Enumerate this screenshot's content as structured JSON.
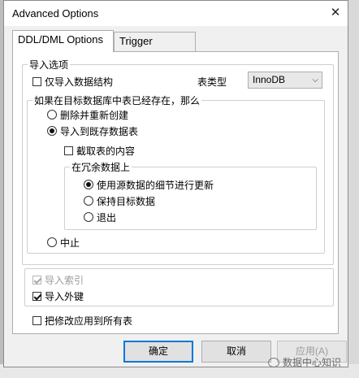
{
  "window": {
    "title": "Advanced Options",
    "close_glyph": "✕"
  },
  "tabs": [
    {
      "label": "DDL/DML Options",
      "active": true
    },
    {
      "label": "Trigger Options",
      "active": false
    }
  ],
  "import_group": {
    "legend": "导入选项",
    "only_structure": {
      "label": "仅导入数据结构",
      "checked": false
    },
    "table_type_label": "表类型",
    "table_type_value": "InnoDB",
    "exists_group": {
      "legend": "如果在目标数据库中表已经存在，那么",
      "delete_recreate": {
        "label": "删除并重新创建",
        "checked": false
      },
      "import_existing": {
        "label": "导入到既存数据表",
        "checked": true
      },
      "truncate": {
        "label": "截取表的内容",
        "checked": false
      },
      "redundant_group": {
        "legend": "在冗余数据上",
        "update_source": {
          "label": "使用源数据的细节进行更新",
          "checked": true
        },
        "keep_target": {
          "label": "保持目标数据",
          "checked": false
        },
        "exit": {
          "label": "退出",
          "checked": false
        }
      },
      "abort": {
        "label": "中止",
        "checked": false
      }
    }
  },
  "index_group": {
    "import_index": {
      "label": "导入索引",
      "checked": true,
      "disabled": true
    },
    "import_fk": {
      "label": "导入外键",
      "checked": true
    }
  },
  "apply_all": {
    "label": "把修改应用到所有表",
    "checked": false
  },
  "buttons": {
    "ok": "确定",
    "cancel": "取消",
    "apply": "应用(A)"
  },
  "watermark": {
    "text": "数据中心知识"
  }
}
